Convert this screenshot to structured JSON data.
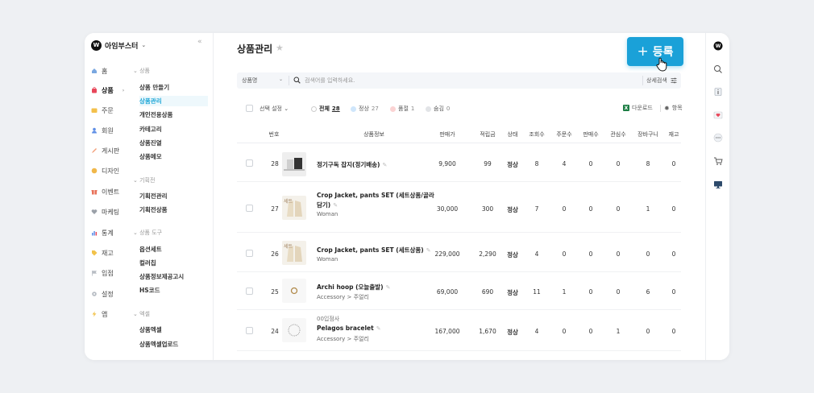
{
  "brand": {
    "name": "아임부스터",
    "logo": "W"
  },
  "nav": [
    {
      "label": "홈",
      "icon": "home-icon",
      "color": "#7aa7e0"
    },
    {
      "label": "상품",
      "icon": "bag-icon",
      "color": "#e8475a",
      "active": true
    },
    {
      "label": "주문",
      "icon": "order-icon",
      "color": "#f3c04b"
    },
    {
      "label": "회원",
      "icon": "user-icon",
      "color": "#5f8fe6"
    },
    {
      "label": "게시판",
      "icon": "board-icon",
      "color": "#f4a07a"
    },
    {
      "label": "디자인",
      "icon": "design-icon",
      "color": "#f0b74a"
    },
    {
      "label": "이벤트",
      "icon": "gift-icon",
      "color": "#e8725a"
    },
    {
      "label": "마케팅",
      "icon": "heart-icon",
      "color": "#9aa0a8"
    },
    {
      "label": "통계",
      "icon": "chart-icon",
      "color": "#5b8de8"
    },
    {
      "label": "재고",
      "icon": "tag-icon",
      "color": "#f2c24a"
    },
    {
      "label": "입점",
      "icon": "flag-icon",
      "color": "#b8bdc4"
    },
    {
      "label": "설정",
      "icon": "gear-icon",
      "color": "#b8bdc4"
    },
    {
      "label": "앱",
      "icon": "bolt-icon",
      "color": "#f2c24a"
    }
  ],
  "subnav": {
    "sections": [
      {
        "title": "상품",
        "items": [
          "상품 만들기",
          "상품관리",
          "개인전용상품",
          "카테고리",
          "상품진열",
          "상품메모"
        ]
      },
      {
        "title": "기획전",
        "items": [
          "기획전관리",
          "기획전상품"
        ]
      },
      {
        "title": "상품 도구",
        "items": [
          "옵션세트",
          "컬러칩",
          "상품정보제공고시",
          "HS코드"
        ]
      },
      {
        "title": "엑셀",
        "items": [
          "상품엑셀",
          "상품엑셀업로드"
        ]
      }
    ],
    "active": "상품관리"
  },
  "page": {
    "title": "상품관리",
    "register_label": "등록",
    "register_color": "#1aa1d8"
  },
  "search": {
    "field": "상품명",
    "placeholder": "검색어를 입력하세요.",
    "advanced": "상세검색"
  },
  "toolbar": {
    "select_label": "선택 설정",
    "filters": [
      {
        "label": "전체",
        "count": "28",
        "color": "#ffffff"
      },
      {
        "label": "정상",
        "count": "27",
        "color": "#cfe6fb"
      },
      {
        "label": "품절",
        "count": "1",
        "color": "#fbd3d3"
      },
      {
        "label": "숨김",
        "count": "0",
        "color": "#e2e4e7"
      }
    ],
    "download": "다운로드",
    "columns": "항목"
  },
  "table": {
    "headers": [
      "번호",
      "상품정보",
      "판매가",
      "적립금",
      "상태",
      "조회수",
      "주문수",
      "판매수",
      "관심수",
      "장바구니",
      "재고"
    ],
    "rows": [
      {
        "no": "28",
        "vendor": "",
        "name": "정기구독 잡지(정기배송)",
        "name2": "",
        "category": "",
        "price": "9,900",
        "points": "99",
        "state": "정상",
        "views": "8",
        "orders": "4",
        "sales": "0",
        "likes": "0",
        "cart": "8",
        "stock": "0"
      },
      {
        "no": "27",
        "vendor": "",
        "name": "Crop Jacket, pants SET (세트상품/골라",
        "name2": "담기)",
        "category": "Woman",
        "price": "30,000",
        "points": "300",
        "state": "정상",
        "views": "7",
        "orders": "0",
        "sales": "0",
        "likes": "0",
        "cart": "1",
        "stock": "0"
      },
      {
        "no": "26",
        "vendor": "",
        "name": "Crop Jacket, pants SET (세트상품)",
        "name2": "",
        "category": "Woman",
        "price": "229,000",
        "points": "2,290",
        "state": "정상",
        "views": "4",
        "orders": "0",
        "sales": "0",
        "likes": "0",
        "cart": "0",
        "stock": "0"
      },
      {
        "no": "25",
        "vendor": "",
        "name": "Archi hoop (오늘출발)",
        "name2": "",
        "category": "Accessory > 주얼리",
        "price": "69,000",
        "points": "690",
        "state": "정상",
        "views": "11",
        "orders": "1",
        "sales": "0",
        "likes": "0",
        "cart": "6",
        "stock": "0"
      },
      {
        "no": "24",
        "vendor": "00입점사",
        "name": "Pelagos bracelet",
        "name2": "",
        "category": "Accessory > 주얼리",
        "price": "167,000",
        "points": "1,670",
        "state": "정상",
        "views": "4",
        "orders": "0",
        "sales": "0",
        "likes": "1",
        "cart": "0",
        "stock": "0"
      }
    ],
    "thumb_badges": [
      "",
      "세트",
      "세트",
      "",
      ""
    ]
  }
}
